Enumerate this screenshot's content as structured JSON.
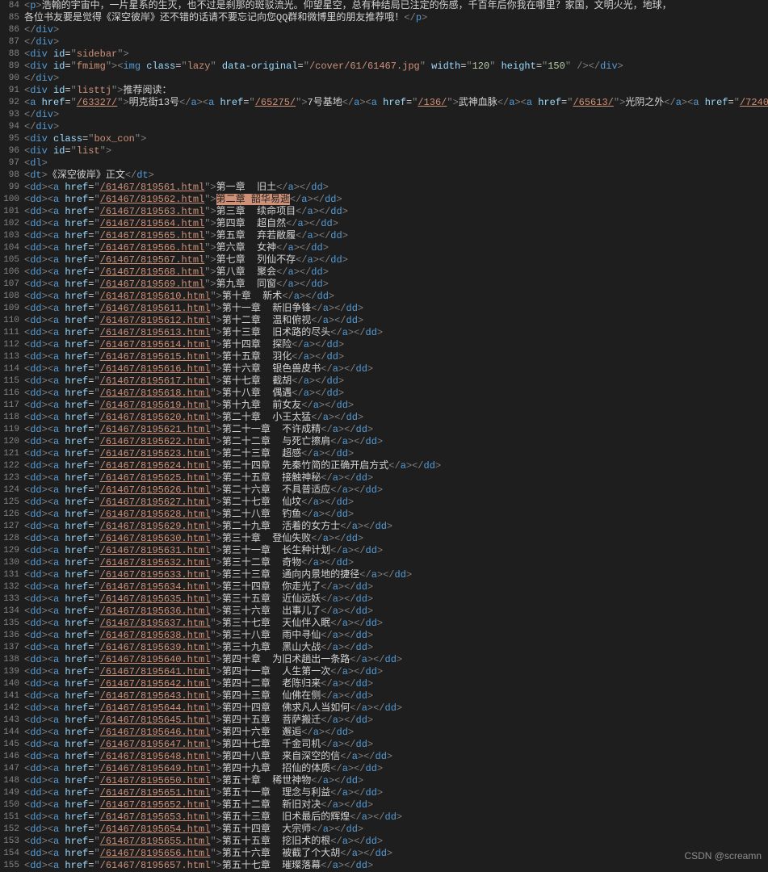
{
  "startLine": 84,
  "watermark": "CSDN @screamn",
  "intro": {
    "p1": "浩翰的宇宙中，一片星系的生灭，也不过是刹那的斑驳流光。仰望星空，总有种结局已注定的伤感，千百年后你我在哪里？家国，文明火光，地球，",
    "p2": "各位书友要是觉得《深空彼岸》还不错的话请不要忘记向您QQ群和微博里的朋友推荐哦！"
  },
  "sidebar_id": "sidebar",
  "fmimg_id": "fmimg",
  "img_class": "lazy",
  "img_attr": "data-original",
  "img_src": "/cover/61/61467.jpg",
  "img_w": "120",
  "img_h": "150",
  "list_id": "listtj",
  "list_label": "推荐阅读：",
  "recs": [
    {
      "href": "/63327/",
      "text": "明克街13号"
    },
    {
      "href": "/65275/",
      "text": "7号基地"
    },
    {
      "href": "/136/",
      "text": "武神血脉"
    },
    {
      "href": "/65613/",
      "text": "光阴之外"
    },
    {
      "href": "/7240",
      "text": ""
    }
  ],
  "boxcon_class": "box_con",
  "list2_id": "list",
  "dt_text": "《深空彼岸》正文",
  "highlight_index": 1,
  "chapters": [
    {
      "href": "/61467/819561.html",
      "title": "第一章  旧土"
    },
    {
      "href": "/61467/819562.html",
      "title": "第二章 韶华易逝"
    },
    {
      "href": "/61467/819563.html",
      "title": "第三章  续命项目"
    },
    {
      "href": "/61467/819564.html",
      "title": "第四章  超自然"
    },
    {
      "href": "/61467/819565.html",
      "title": "第五章  弃若敝履"
    },
    {
      "href": "/61467/819566.html",
      "title": "第六章  女神"
    },
    {
      "href": "/61467/819567.html",
      "title": "第七章  列仙不存"
    },
    {
      "href": "/61467/819568.html",
      "title": "第八章  聚会"
    },
    {
      "href": "/61467/819569.html",
      "title": "第九章  同窗"
    },
    {
      "href": "/61467/8195610.html",
      "title": "第十章  新术"
    },
    {
      "href": "/61467/8195611.html",
      "title": "第十一章  新旧争锋"
    },
    {
      "href": "/61467/8195612.html",
      "title": "第十二章  温和俯视"
    },
    {
      "href": "/61467/8195613.html",
      "title": "第十三章  旧术路的尽头"
    },
    {
      "href": "/61467/8195614.html",
      "title": "第十四章  探险"
    },
    {
      "href": "/61467/8195615.html",
      "title": "第十五章  羽化"
    },
    {
      "href": "/61467/8195616.html",
      "title": "第十六章  银色兽皮书"
    },
    {
      "href": "/61467/8195617.html",
      "title": "第十七章  截胡"
    },
    {
      "href": "/61467/8195618.html",
      "title": "第十八章  偶遇"
    },
    {
      "href": "/61467/8195619.html",
      "title": "第十九章  前女友"
    },
    {
      "href": "/61467/8195620.html",
      "title": "第二十章  小王太猛"
    },
    {
      "href": "/61467/8195621.html",
      "title": "第二十一章  不许成精"
    },
    {
      "href": "/61467/8195622.html",
      "title": "第二十二章  与死亡擦肩"
    },
    {
      "href": "/61467/8195623.html",
      "title": "第二十三章  超感"
    },
    {
      "href": "/61467/8195624.html",
      "title": "第二十四章  先秦竹简的正确开启方式"
    },
    {
      "href": "/61467/8195625.html",
      "title": "第二十五章  接触神秘"
    },
    {
      "href": "/61467/8195626.html",
      "title": "第二十六章  不具普适应"
    },
    {
      "href": "/61467/8195627.html",
      "title": "第二十七章  仙坟"
    },
    {
      "href": "/61467/8195628.html",
      "title": "第二十八章  钓鱼"
    },
    {
      "href": "/61467/8195629.html",
      "title": "第二十九章  活着的女方士"
    },
    {
      "href": "/61467/8195630.html",
      "title": "第三十章  登仙失败"
    },
    {
      "href": "/61467/8195631.html",
      "title": "第三十一章  长生种计划"
    },
    {
      "href": "/61467/8195632.html",
      "title": "第三十二章  奇物"
    },
    {
      "href": "/61467/8195633.html",
      "title": "第三十三章  通向内景地的捷径"
    },
    {
      "href": "/61467/8195634.html",
      "title": "第三十四章  你走光了"
    },
    {
      "href": "/61467/8195635.html",
      "title": "第三十五章  近仙远妖"
    },
    {
      "href": "/61467/8195636.html",
      "title": "第三十六章  出事儿了"
    },
    {
      "href": "/61467/8195637.html",
      "title": "第三十七章  天仙伴入眠"
    },
    {
      "href": "/61467/8195638.html",
      "title": "第三十八章  雨中寻仙"
    },
    {
      "href": "/61467/8195639.html",
      "title": "第三十九章  黑山大战"
    },
    {
      "href": "/61467/8195640.html",
      "title": "第四十章  为旧术趟出一条路"
    },
    {
      "href": "/61467/8195641.html",
      "title": "第四十一章  人生第一次"
    },
    {
      "href": "/61467/8195642.html",
      "title": "第四十二章  老陈归来"
    },
    {
      "href": "/61467/8195643.html",
      "title": "第四十三章  仙佛在侧"
    },
    {
      "href": "/61467/8195644.html",
      "title": "第四十四章  佛求凡人当如何"
    },
    {
      "href": "/61467/8195645.html",
      "title": "第四十五章  菩萨搬迁"
    },
    {
      "href": "/61467/8195646.html",
      "title": "第四十六章  邂逅"
    },
    {
      "href": "/61467/8195647.html",
      "title": "第四十七章  千金司机"
    },
    {
      "href": "/61467/8195648.html",
      "title": "第四十八章  来自深空的信"
    },
    {
      "href": "/61467/8195649.html",
      "title": "第四十九章  招仙的体质"
    },
    {
      "href": "/61467/8195650.html",
      "title": "第五十章  稀世神物"
    },
    {
      "href": "/61467/8195651.html",
      "title": "第五十一章  理念与利益"
    },
    {
      "href": "/61467/8195652.html",
      "title": "第五十二章  新旧对决"
    },
    {
      "href": "/61467/8195653.html",
      "title": "第五十三章  旧术最后的辉煌"
    },
    {
      "href": "/61467/8195654.html",
      "title": "第五十四章  大宗师"
    },
    {
      "href": "/61467/8195655.html",
      "title": "第五十五章  挖旧术的根"
    },
    {
      "href": "/61467/8195656.html",
      "title": "第五十六章  被截了个大胡"
    },
    {
      "href": "/61467/8195657.html",
      "title": "第五十七章  璀璨落幕"
    }
  ]
}
